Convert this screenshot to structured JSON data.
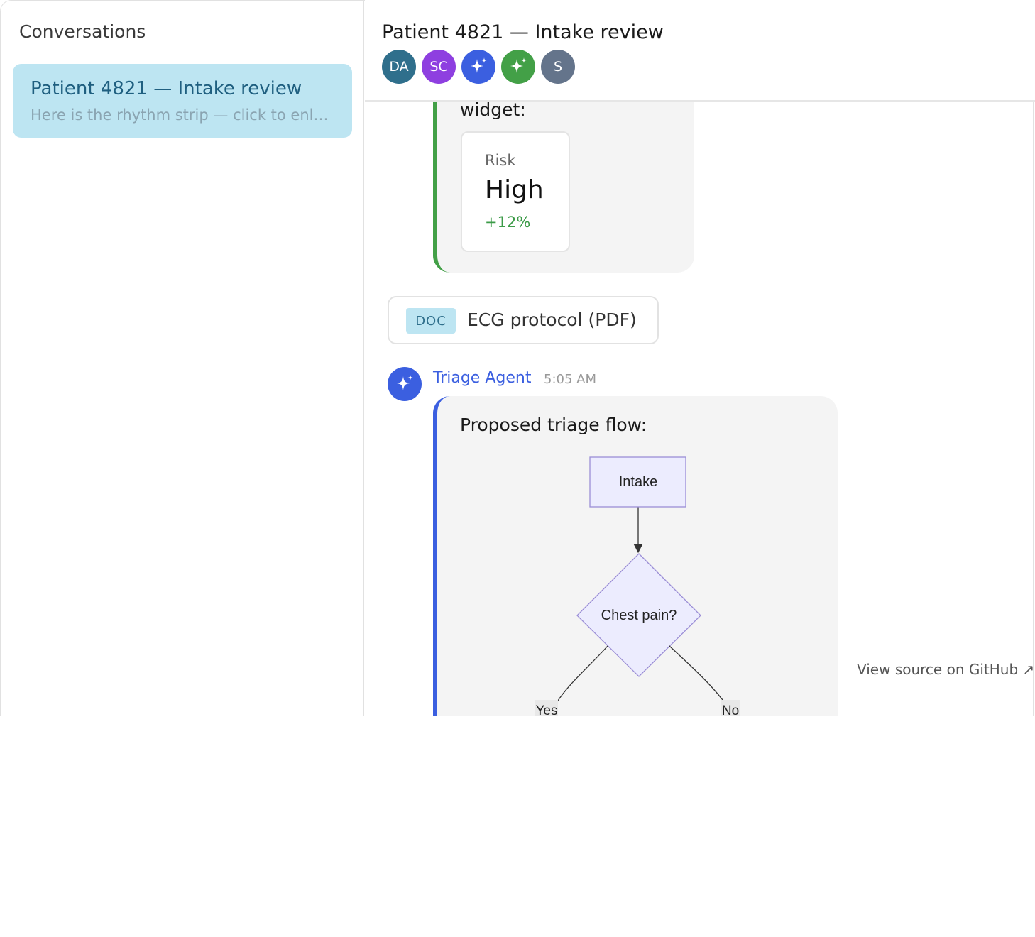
{
  "sidebar": {
    "title": "Conversations",
    "conversations": [
      {
        "title": "Patient 4821 — Intake review",
        "preview": "Here is the rhythm strip — click to enl…",
        "selected": true
      }
    ]
  },
  "chat": {
    "title": "Patient 4821 — Intake review",
    "participants": [
      {
        "initials": "DA",
        "color": "#2f6f8c"
      },
      {
        "initials": "SC",
        "color": "#8e3fe0"
      },
      {
        "icon": "sparkle-icon",
        "color": "#3b5fe0"
      },
      {
        "icon": "sparkle-icon",
        "color": "#43a047"
      },
      {
        "initials": "S",
        "color": "#64748b"
      }
    ]
  },
  "messages": {
    "widget_message": {
      "text": "widget:",
      "accent": "#43a047",
      "stat": {
        "label": "Risk",
        "value": "High",
        "delta": "+12%"
      }
    },
    "attachment": {
      "badge": "DOC",
      "name": "ECG protocol (PDF)"
    },
    "agent_message": {
      "author": "Triage Agent",
      "time": "5:05 AM",
      "accent": "#3b5fe0",
      "text": "Proposed triage flow:",
      "flowchart": {
        "nodes": [
          {
            "id": "intake",
            "label": "Intake",
            "shape": "rect"
          },
          {
            "id": "chest",
            "label": "Chest pain?",
            "shape": "diamond"
          }
        ],
        "edges": [
          {
            "from": "intake",
            "to": "chest",
            "label": ""
          },
          {
            "from": "chest",
            "to": "yes-branch",
            "label": "Yes"
          },
          {
            "from": "chest",
            "to": "no-branch",
            "label": "No"
          }
        ]
      }
    }
  },
  "footer": {
    "github_link": "View source on GitHub ↗"
  }
}
